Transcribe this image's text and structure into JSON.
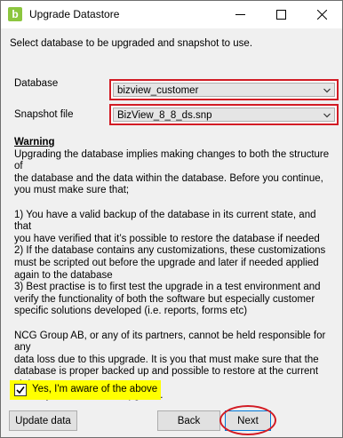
{
  "window": {
    "title": "Upgrade Datastore",
    "app_icon_letter": "b"
  },
  "intro": "Select database to be upgraded and snapshot to use.",
  "database": {
    "label": "Database",
    "value": "bizview_customer"
  },
  "snapshot": {
    "label": "Snapshot file",
    "value": "BizView_8_8_ds.snp"
  },
  "warning": {
    "title": "Warning",
    "lead": "Upgrading the database implies making changes to both the structure of\nthe database and the data within the database. Before you continue,\nyou must make sure that;",
    "point1": "1)  You have a valid backup of the database in its current state, and that\nyou have verified that it’s possible to restore the database if needed",
    "point2": "2)  If the database contains any customizations, these customizations\nmust be scripted out before the upgrade and later if needed applied\nagain to the database",
    "point3": "3)  Best practise is to first test the upgrade in a test environment and\nverify the functionality of both the software but especially customer\nspecific solutions developed (i.e. reports, forms etc)",
    "disclaimer": "NCG Group AB, or any of its partners, cannot be held responsible for any\ndata loss due to this upgrade. It is you that must make sure that the\ndatabase is proper backed up and possible to restore at the current state\nbefore you execute this upgrade."
  },
  "ack": {
    "label": "Yes, I'm aware of the above",
    "checked": true
  },
  "buttons": {
    "update": "Update data",
    "back": "Back",
    "next": "Next"
  },
  "colors": {
    "highlight_red": "#d21b24",
    "highlight_yellow": "#ffff00",
    "app_icon": "#8cc63f"
  }
}
